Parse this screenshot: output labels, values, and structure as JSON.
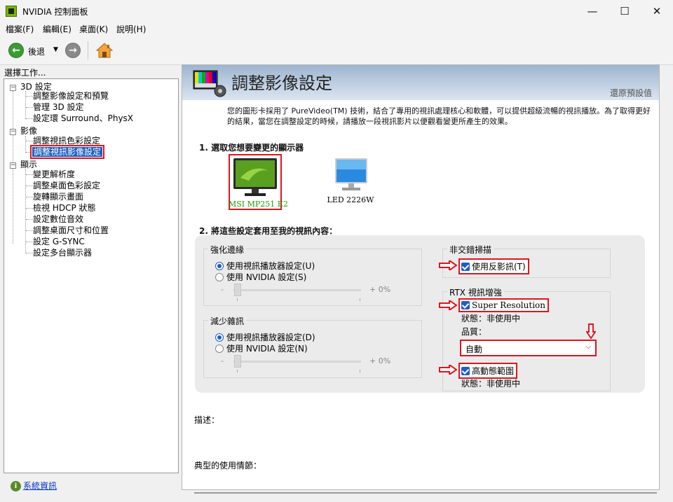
{
  "window": {
    "title": "NVIDIA 控制面板",
    "min": "—",
    "max": "☐",
    "close": "✕"
  },
  "menu": [
    "檔案(F)",
    "編輯(E)",
    "桌面(K)",
    "說明(H)"
  ],
  "toolbar": {
    "back_label": "後退"
  },
  "left": {
    "header": "選擇工作...",
    "tree": [
      {
        "label": "3D 設定",
        "level": 0
      },
      {
        "label": "調整影像設定和預覽",
        "level": 1
      },
      {
        "label": "管理 3D 設定",
        "level": 1
      },
      {
        "label": "設定環 Surround、PhysX",
        "level": 1
      },
      {
        "label": "影像",
        "level": 0
      },
      {
        "label": "調整視訊色彩設定",
        "level": 1
      },
      {
        "label": "調整視訊影像設定",
        "level": 1,
        "selected": true
      },
      {
        "label": "顯示",
        "level": 0
      },
      {
        "label": "變更解析度",
        "level": 1
      },
      {
        "label": "調整桌面色彩設定",
        "level": 1
      },
      {
        "label": "旋轉顯示畫面",
        "level": 1
      },
      {
        "label": "檢視 HDCP 狀態",
        "level": 1
      },
      {
        "label": "設定數位音效",
        "level": 1
      },
      {
        "label": "調整桌面尺寸和位置",
        "level": 1
      },
      {
        "label": "設定 G-SYNC",
        "level": 1
      },
      {
        "label": "設定多台顯示器",
        "level": 1
      }
    ],
    "system_info": "系統資訊"
  },
  "main": {
    "title": "調整影像設定",
    "restore_defaults": "還原預設值",
    "description": "您的圖形卡採用了 PureVideo(TM) 技術，結合了專用的視訊處理核心和軟體，可以提供超級流暢的視訊播放。為了取得更好的結果，當您在調整設定的時候，請播放一段視訊影片以便觀看變更所產生的效果。",
    "section1": "1. 選取您想要變更的顯示器",
    "monitors": [
      {
        "name": "MSI MP251 E2",
        "selected": true
      },
      {
        "name": "LED 2226W",
        "selected": false
      }
    ],
    "section2": "2. 將這些設定套用至我的視訊內容：",
    "edge": {
      "title": "強化邊緣",
      "opt_player": "使用視訊播放器設定(U)",
      "opt_nvidia": "使用 NVIDIA 設定(S)",
      "min": "-",
      "value": "+ 0%"
    },
    "noise": {
      "title": "減少雜訊",
      "opt_player": "使用視訊播放器設定(D)",
      "opt_nvidia": "使用 NVIDIA 設定(N)",
      "min": "-",
      "value": "+ 0%"
    },
    "deinterlace": {
      "title": "非交錯掃描",
      "inverse_telecine": "使用反影訊(T)"
    },
    "rtx": {
      "title": "RTX 視訊增強",
      "super_resolution": "Super Resolution",
      "sr_status": "狀態：非使用中",
      "quality_label": "品質：",
      "quality_value": "自動",
      "hdr": "高動態範圍",
      "hdr_status": "狀態：非使用中"
    },
    "desc_label": "描述：",
    "typical_label": "典型的使用情節："
  },
  "colors": {
    "accent": "#1f5fbf",
    "highlight": "#e0141e",
    "nvidia_green": "#76b900"
  }
}
